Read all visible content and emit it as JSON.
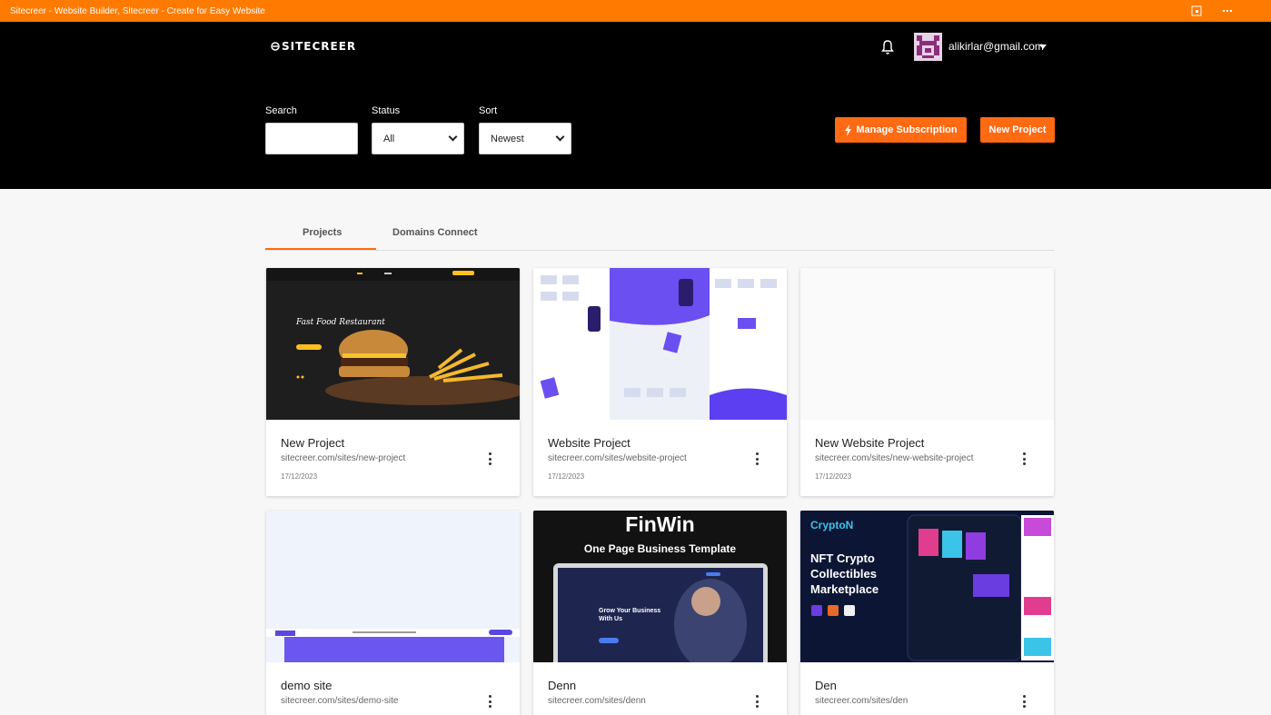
{
  "titlebar": {
    "title": "Sitecreer - Website Builder, Sitecreer - Create for Easy Website"
  },
  "header": {
    "logo_text": "SITECREER",
    "user_email": "alikirlar@gmail.com"
  },
  "filters": {
    "search_label": "Search",
    "search_value": "",
    "status_label": "Status",
    "status_value": "All",
    "sort_label": "Sort",
    "sort_value": "Newest"
  },
  "actions": {
    "manage_subscription": "Manage Subscription",
    "new_project": "New Project"
  },
  "tabs": [
    {
      "label": "Projects",
      "active": true
    },
    {
      "label": "Domains Connect",
      "active": false
    }
  ],
  "projects": [
    {
      "title": "New Project",
      "url": "sitecreer.com/sites/new-project",
      "date": "17/12/2023",
      "thumb_heading": "Fast Food Restaurant"
    },
    {
      "title": "Website Project",
      "url": "sitecreer.com/sites/website-project",
      "date": "17/12/2023"
    },
    {
      "title": "New Website Project",
      "url": "sitecreer.com/sites/new-website-project",
      "date": "17/12/2023"
    },
    {
      "title": "demo site",
      "url": "sitecreer.com/sites/demo-site",
      "date": ""
    },
    {
      "title": "Denn",
      "url": "sitecreer.com/sites/denn",
      "date": "",
      "thumb_heading": "FinWin",
      "thumb_sub": "One Page Business Template",
      "thumb_hero": "Grow Your Business With Us"
    },
    {
      "title": "Den",
      "url": "sitecreer.com/sites/den",
      "date": "",
      "thumb_heading": "CryptoN",
      "thumb_sub": "NFT Crypto Collectibles Marketplace"
    }
  ],
  "colors": {
    "accent": "#ff6a13",
    "titlebar": "#ff7a00",
    "header_bg": "#000000"
  }
}
